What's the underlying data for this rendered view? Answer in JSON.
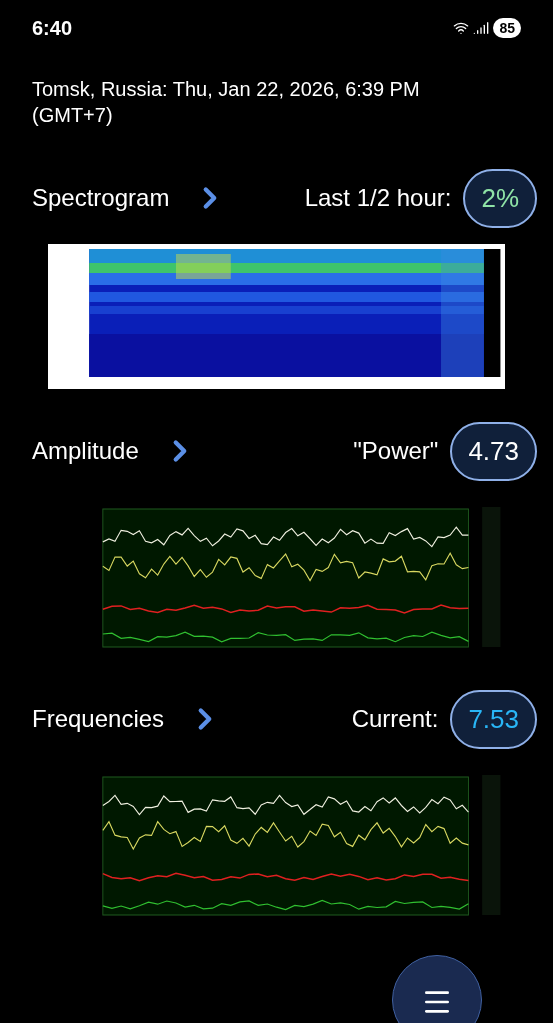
{
  "status_bar": {
    "time": "6:40",
    "battery": "85"
  },
  "location": "Tomsk, Russia: Thu, Jan 22, 2026, 6:39 PM (GMT+7)",
  "sections": [
    {
      "kind": "spectrogram",
      "title": "Spectrogram",
      "stat_label": "Last 1/2 hour:",
      "stat_value": "2%",
      "color": "#8fe3a6"
    },
    {
      "kind": "lines",
      "title": "Amplitude",
      "stat_label": "\"Power\"",
      "stat_value": "4.73",
      "color": "#ffffff"
    },
    {
      "kind": "lines",
      "title": "Frequencies",
      "stat_label": "Current:",
      "stat_value": "7.53",
      "color": "#29b6f6"
    }
  ]
}
